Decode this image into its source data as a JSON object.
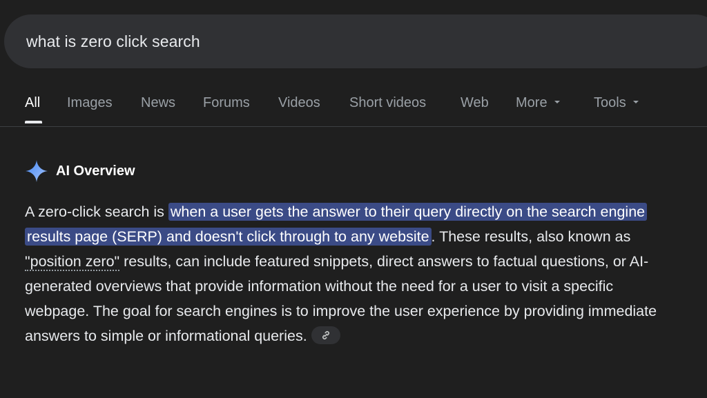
{
  "search": {
    "query": "what is zero click search"
  },
  "tabs": [
    {
      "label": "All",
      "active": true
    },
    {
      "label": "Images"
    },
    {
      "label": "News"
    },
    {
      "label": "Forums"
    },
    {
      "label": "Videos"
    },
    {
      "label": "Short videos"
    },
    {
      "label": "Web"
    },
    {
      "label": "More",
      "dropdown": true
    },
    {
      "label": "Tools",
      "dropdown": true
    }
  ],
  "ai_overview": {
    "title": "AI Overview",
    "text_intro": "A zero-click search is ",
    "text_highlight": "when a user gets the answer to their query directly on the search engine results page (SERP) and doesn't click through to any website",
    "text_after_highlight": ". These results, also known as ",
    "text_term": "\"position zero\"",
    "text_rest": " results, can include featured snippets, direct answers to factual questions, or AI-generated overviews that provide information without the need for a user to visit a specific webpage. The goal for search engines is to improve the user experience by providing immediate answers to simple or informational queries."
  },
  "colors": {
    "background": "#1f1f1f",
    "search_bar": "#303134",
    "highlight": "#3b4b86",
    "tab_inactive": "#9aa0a6",
    "spark_gradient_start": "#4285f4",
    "spark_gradient_end": "#a8c7fa"
  },
  "icons": {
    "ai": "sparkle-icon",
    "source": "link-icon",
    "dropdown": "caret-down-icon"
  }
}
